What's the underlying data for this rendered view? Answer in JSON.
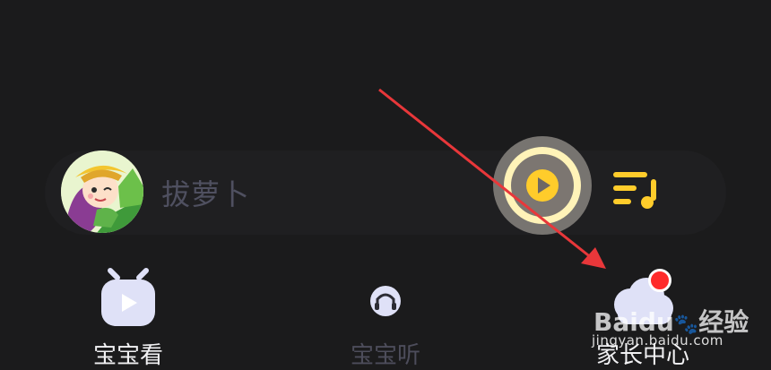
{
  "player": {
    "track_title": "拔萝卜",
    "cover_icon": "cartoon-girl-avatar",
    "play_icon": "play-icon",
    "playlist_icon": "playlist-icon"
  },
  "tabs": [
    {
      "label": "宝宝看",
      "icon": "tv-icon",
      "active": true
    },
    {
      "label": "宝宝听",
      "icon": "headphones-icon",
      "active": false
    },
    {
      "label": "家长中心",
      "icon": "cloud-icon",
      "active": false,
      "badge": true
    }
  ],
  "watermark": {
    "brand": "Baidu",
    "brand_cn": "经验",
    "url": "jingyan.baidu.com"
  },
  "colors": {
    "background": "#1b1b1c",
    "accent_yellow": "#ffcc2b",
    "badge_red": "#ff2a2a",
    "arrow_red": "#e8373a",
    "tab_icon": "#dfe1f7"
  }
}
